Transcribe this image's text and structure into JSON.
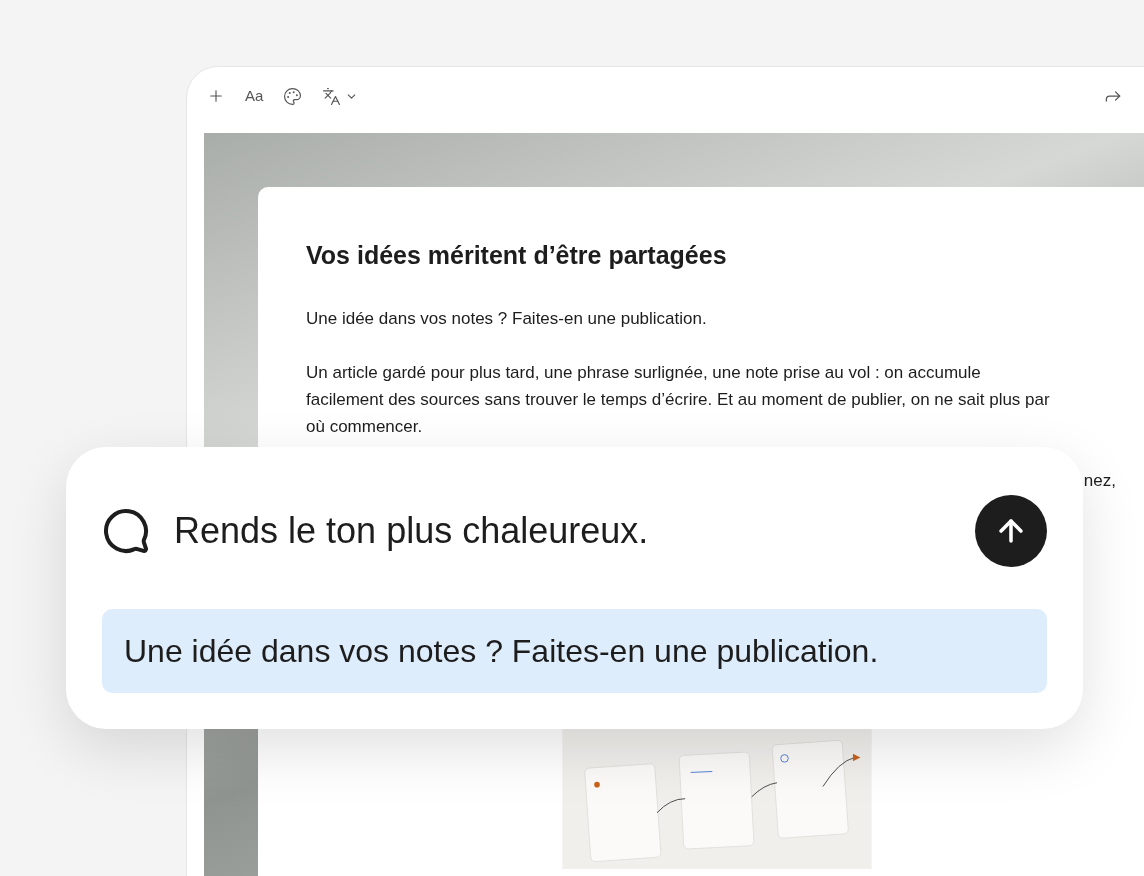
{
  "toolbar": {
    "format_label": "Aa"
  },
  "document": {
    "title": "Vos idées méritent d’être partagées",
    "paragraphs": [
      "Une idée dans vos notes ? Faites-en une publication.",
      "Un article gardé pour plus tard, une phrase surlignée, une note prise au vol : on accumule facilement des sources sans trouver le temps d’écrire. Et au moment de publier, on ne sait plus par où commencer.",
      "nez,"
    ]
  },
  "prompt": {
    "text": "Rends le ton plus chaleureux.",
    "selection": "Une idée dans vos notes ? Faites-en une publication."
  }
}
